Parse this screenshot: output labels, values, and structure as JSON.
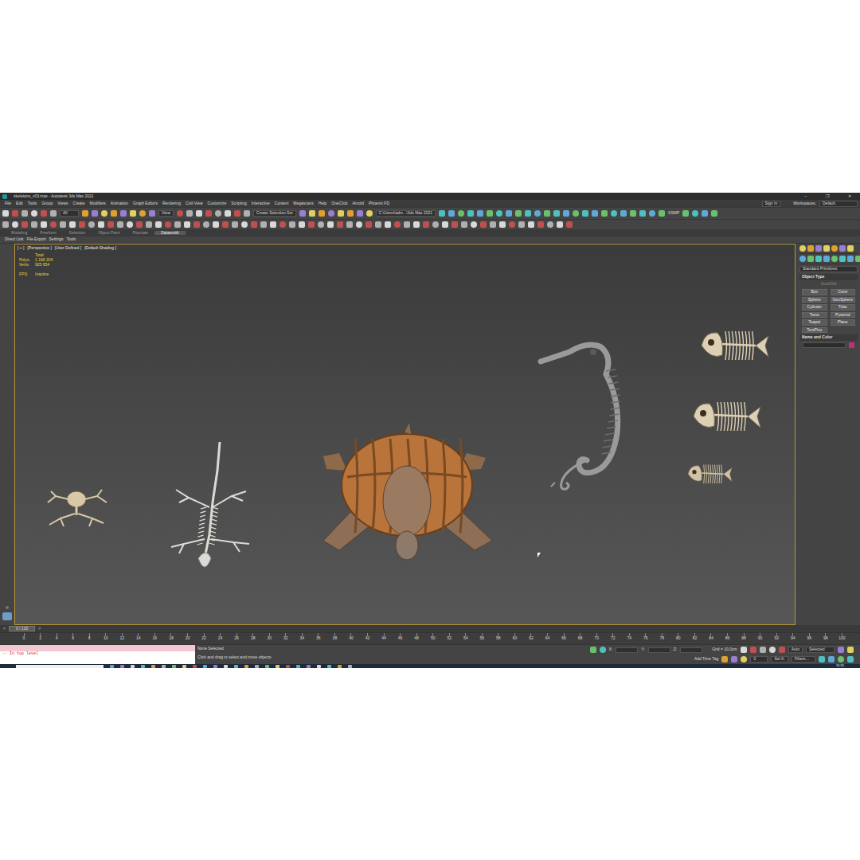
{
  "window": {
    "title": "skeletons_v03.max - Autodesk 3ds Max 2021",
    "controls": [
      "–",
      "❐",
      "✕"
    ]
  },
  "menu": [
    "File",
    "Edit",
    "Tools",
    "Group",
    "Views",
    "Create",
    "Modifiers",
    "Animation",
    "Graph Editors",
    "Rendering",
    "Civil View",
    "Customize",
    "Scripting",
    "Interactive",
    "Content",
    "Megascans",
    "Help",
    "OneClick",
    "Arnold",
    "Phoenix FD"
  ],
  "account": {
    "label": "Sign In"
  },
  "workspace": {
    "label": "Workspaces:",
    "value": "Default"
  },
  "toolbar": {
    "selection_filter": "All",
    "reference": "View",
    "selection_set": "Create Selection Set",
    "project_path": "C:\\Users\\adm...\\3ds Max 2021",
    "keyboard": "KSMP"
  },
  "ribbon": {
    "tabs": [
      {
        "label": "Modeling",
        "selected": false
      },
      {
        "label": "Freeform",
        "selected": false
      },
      {
        "label": "Selection",
        "selected": false
      },
      {
        "label": "Object Paint",
        "selected": false
      },
      {
        "label": "Populate",
        "selected": false
      },
      {
        "label": "Datasmith",
        "selected": true
      }
    ],
    "items": [
      "Direct Link",
      "File Export",
      "Settings",
      "Tools"
    ]
  },
  "viewport": {
    "labels": [
      "[ + ]",
      "[Perspective ]",
      "[User Defined ]",
      "[Default Shading ]"
    ],
    "stats": [
      {
        "label": "",
        "value": "Total"
      },
      {
        "label": "Polys:",
        "value": "1 166 204"
      },
      {
        "label": "Verts:",
        "value": "925 654"
      },
      {
        "label": "",
        "value": ""
      },
      {
        "label": "FPS:",
        "value": "Inactive"
      }
    ],
    "active": true,
    "models": [
      {
        "kind": "frog",
        "color": "#d9c8a6"
      },
      {
        "kind": "lizard",
        "color": "#dcdad4"
      },
      {
        "kind": "turtle",
        "color": "#b8743a"
      },
      {
        "kind": "seahorse",
        "color": "#9a9a98"
      },
      {
        "kind": "fish",
        "color": "#ddd0b4"
      },
      {
        "kind": "fish",
        "color": "#ddd0b4"
      },
      {
        "kind": "fish",
        "color": "#d2c3a4"
      }
    ]
  },
  "command_panel": {
    "category": "Standard Primitives",
    "rollouts": [
      {
        "title": "Object Type",
        "expanded": true
      },
      {
        "title": "Name and Color",
        "expanded": true
      }
    ],
    "autogrid": "AutoGrid",
    "buttons": [
      "Box",
      "Cone",
      "Sphere",
      "GeoSphere",
      "Cylinder",
      "Tube",
      "Torus",
      "Pyramid",
      "Teapot",
      "Plane",
      "TextPlus"
    ],
    "object_color": "#c0307a"
  },
  "timeline": {
    "prev": "<",
    "frame": "0 / 100",
    "next": ">",
    "ticks": [
      "0",
      "2",
      "4",
      "6",
      "8",
      "10",
      "12",
      "14",
      "16",
      "18",
      "20",
      "22",
      "24",
      "26",
      "28",
      "30",
      "32",
      "34",
      "36",
      "38",
      "40",
      "42",
      "44",
      "46",
      "48",
      "50",
      "52",
      "54",
      "56",
      "58",
      "60",
      "62",
      "64",
      "66",
      "68",
      "70",
      "72",
      "74",
      "76",
      "78",
      "80",
      "82",
      "84",
      "86",
      "88",
      "90",
      "92",
      "94",
      "96",
      "98",
      "100"
    ]
  },
  "status": {
    "listener": "-- In top level",
    "selection": "None Selected",
    "prompt": "Click and drag to select and move objects",
    "x": "X:",
    "y": "Y:",
    "z": "Z:",
    "grid": "Grid = 10,0cm",
    "time_tag": "Add Time Tag",
    "key_mode": "Auto",
    "key_filter": "Selected",
    "set_key": "Set K.",
    "filters": "Filters...",
    "frame": "0"
  },
  "taskbar": {
    "time": "15:55"
  }
}
